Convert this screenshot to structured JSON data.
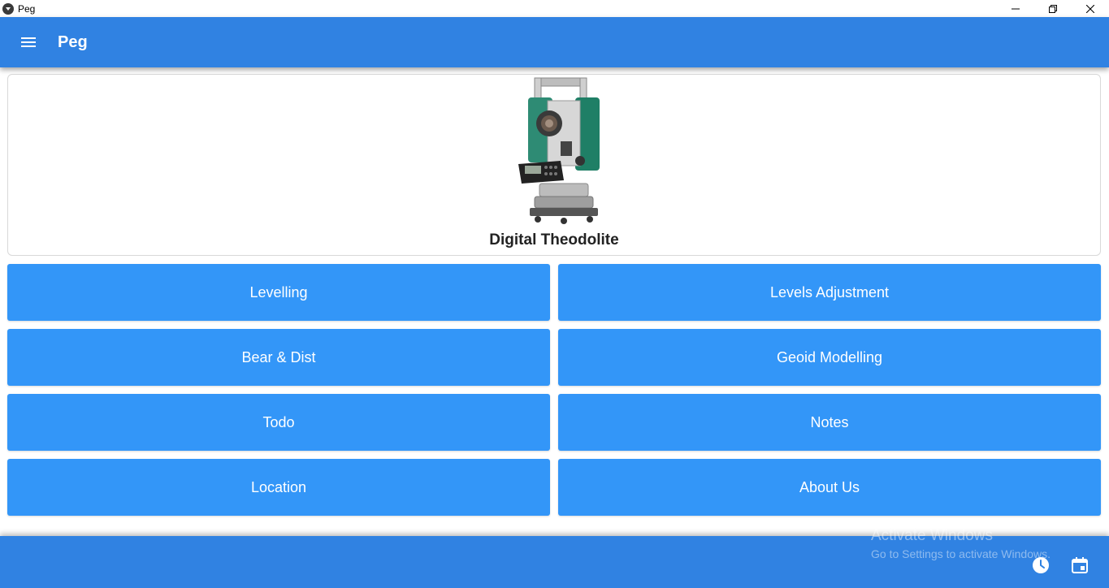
{
  "window": {
    "title": "Peg",
    "controls": {
      "minimize": "minimize-icon",
      "restore": "restore-icon",
      "close": "close-icon"
    }
  },
  "appbar": {
    "menu_icon": "menu-icon",
    "title": "Peg"
  },
  "hero": {
    "image_icon": "theodolite-image",
    "caption": "Digital Theodolite"
  },
  "buttons": [
    {
      "label": "Levelling"
    },
    {
      "label": "Levels Adjustment"
    },
    {
      "label": "Bear & Dist"
    },
    {
      "label": "Geoid Modelling"
    },
    {
      "label": "Todo"
    },
    {
      "label": "Notes"
    },
    {
      "label": "Location"
    },
    {
      "label": "About Us"
    }
  ],
  "bottombar": {
    "clock_icon": "clock-icon",
    "calendar_icon": "calendar-icon"
  },
  "watermark": {
    "line1": "Activate Windows",
    "line2": "Go to Settings to activate Windows."
  },
  "colors": {
    "appbar": "#3082e2",
    "button": "#3396f8",
    "text_light": "#ffffff"
  }
}
